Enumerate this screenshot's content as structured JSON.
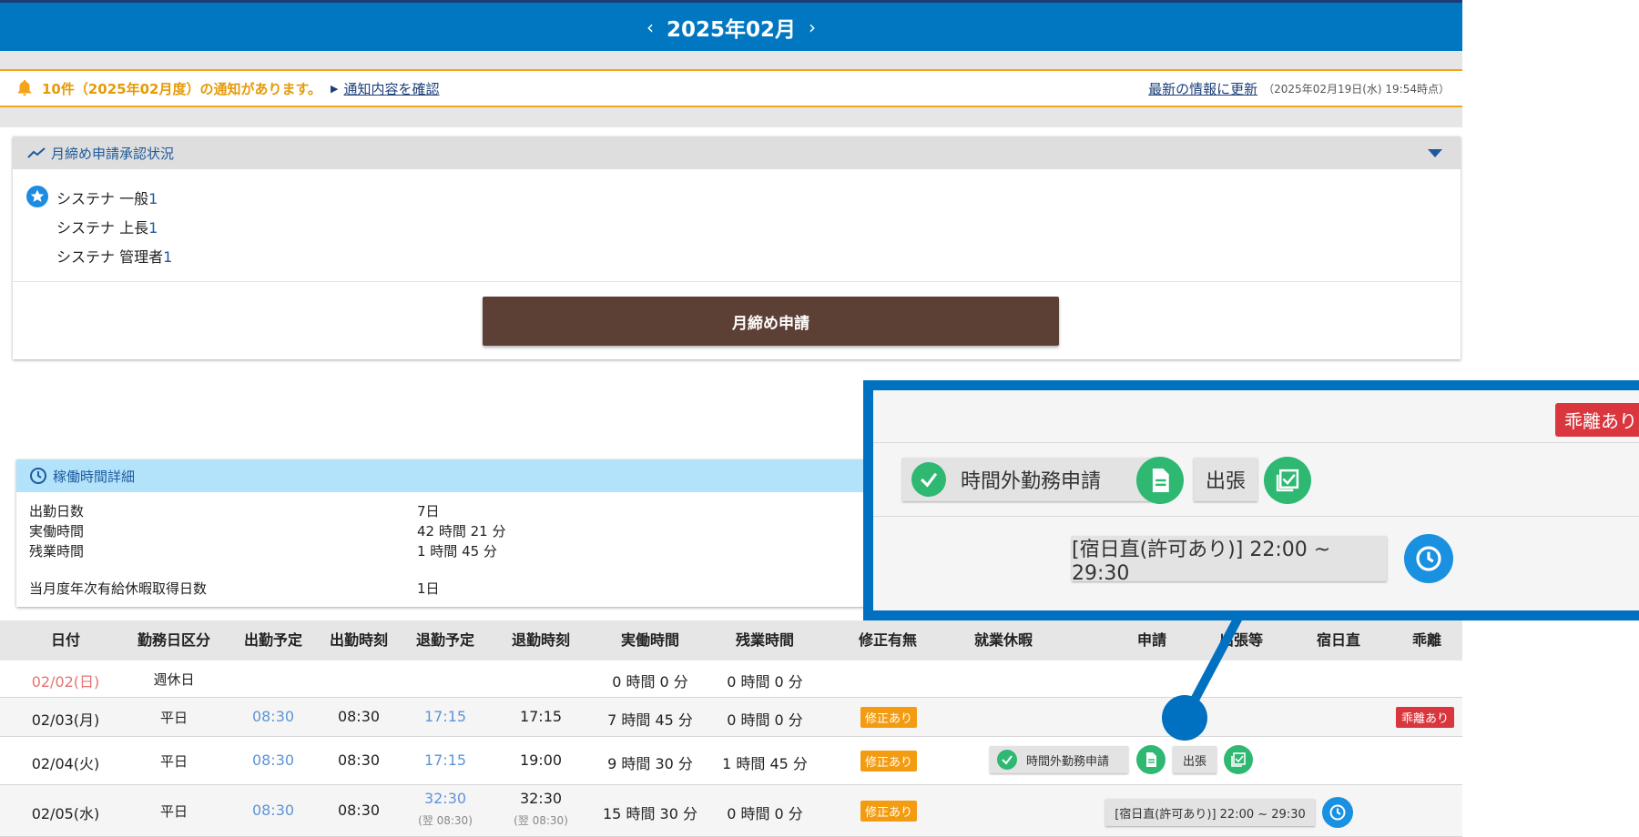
{
  "header": {
    "month": "2025年02月",
    "prev": "‹",
    "next": "›"
  },
  "notice": {
    "message": "10件（2025年02月度）の通知があります。",
    "confirm_link": "通知内容を確認",
    "refresh_link": "最新の情報に更新",
    "timestamp": "（2025年02月19日(水) 19:54時点）"
  },
  "approval": {
    "title": "月締め申請承認状況",
    "approvers": [
      {
        "name": "システナ 一般",
        "count": "1"
      },
      {
        "name": "システナ 上長",
        "count": "1"
      },
      {
        "name": "システナ 管理者",
        "count": "1"
      }
    ],
    "submit_label": "月締め申請"
  },
  "detail": {
    "title": "稼働時間詳細",
    "rows": [
      {
        "label": "出勤日数",
        "value": "7日"
      },
      {
        "label": "実働時間",
        "value": "42 時間 21 分"
      },
      {
        "label": "残業時間",
        "value": "1 時間 45 分"
      },
      {
        "label": "当月度年次有給休暇取得日数",
        "value": "1日"
      }
    ]
  },
  "table": {
    "headers": [
      "日付",
      "勤務日区分",
      "出勤予定",
      "出勤時刻",
      "退勤予定",
      "退勤時刻",
      "実働時間",
      "残業時間",
      "修正有無",
      "就業休暇",
      "申請",
      "出張等",
      "宿日直",
      "乖離"
    ],
    "rows": [
      {
        "date": "02/02(日)",
        "kind": "週休日",
        "plan_in": "",
        "in": "",
        "plan_out": "",
        "out": "",
        "work": "0 時間 0 分",
        "overtime": "0 時間 0 分",
        "fix": "",
        "divergence": ""
      },
      {
        "date": "02/03(月)",
        "kind": "平日",
        "plan_in": "08:30",
        "in": "08:30",
        "plan_out": "17:15",
        "out": "17:15",
        "work": "7 時間 45 分",
        "overtime": "0 時間 0 分",
        "fix": "修正あり",
        "divergence": "乖離あり"
      },
      {
        "date": "02/04(火)",
        "kind": "平日",
        "plan_in": "08:30",
        "in": "08:30",
        "plan_out": "17:15",
        "out": "19:00",
        "work": "9 時間 30 分",
        "overtime": "1 時間 45 分",
        "fix": "修正あり",
        "apply": "時間外勤務申請",
        "trip": "出張",
        "divergence": ""
      },
      {
        "date": "02/05(水)",
        "kind": "平日",
        "plan_in": "08:30",
        "in": "08:30",
        "plan_out": "32:30",
        "plan_out_sub": "(翌 08:30)",
        "out": "32:30",
        "out_sub": "(翌 08:30)",
        "work": "15 時間 30 分",
        "overtime": "0 時間 0 分",
        "fix": "修正あり",
        "duty": "[宿日直(許可あり)] 22:00 ~ 29:30",
        "divergence": ""
      }
    ]
  },
  "zoom": {
    "badge": "乖離あり",
    "apply": "時間外勤務申請",
    "trip": "出張",
    "duty": "[宿日直(許可あり)] 22:00 ~ 29:30"
  },
  "colors": {
    "primary": "#0077c0",
    "notice": "#f3a41b",
    "submit": "#5d4035",
    "green": "#2eb872",
    "badge_orange": "#f39c12",
    "badge_red": "#d9363e"
  }
}
